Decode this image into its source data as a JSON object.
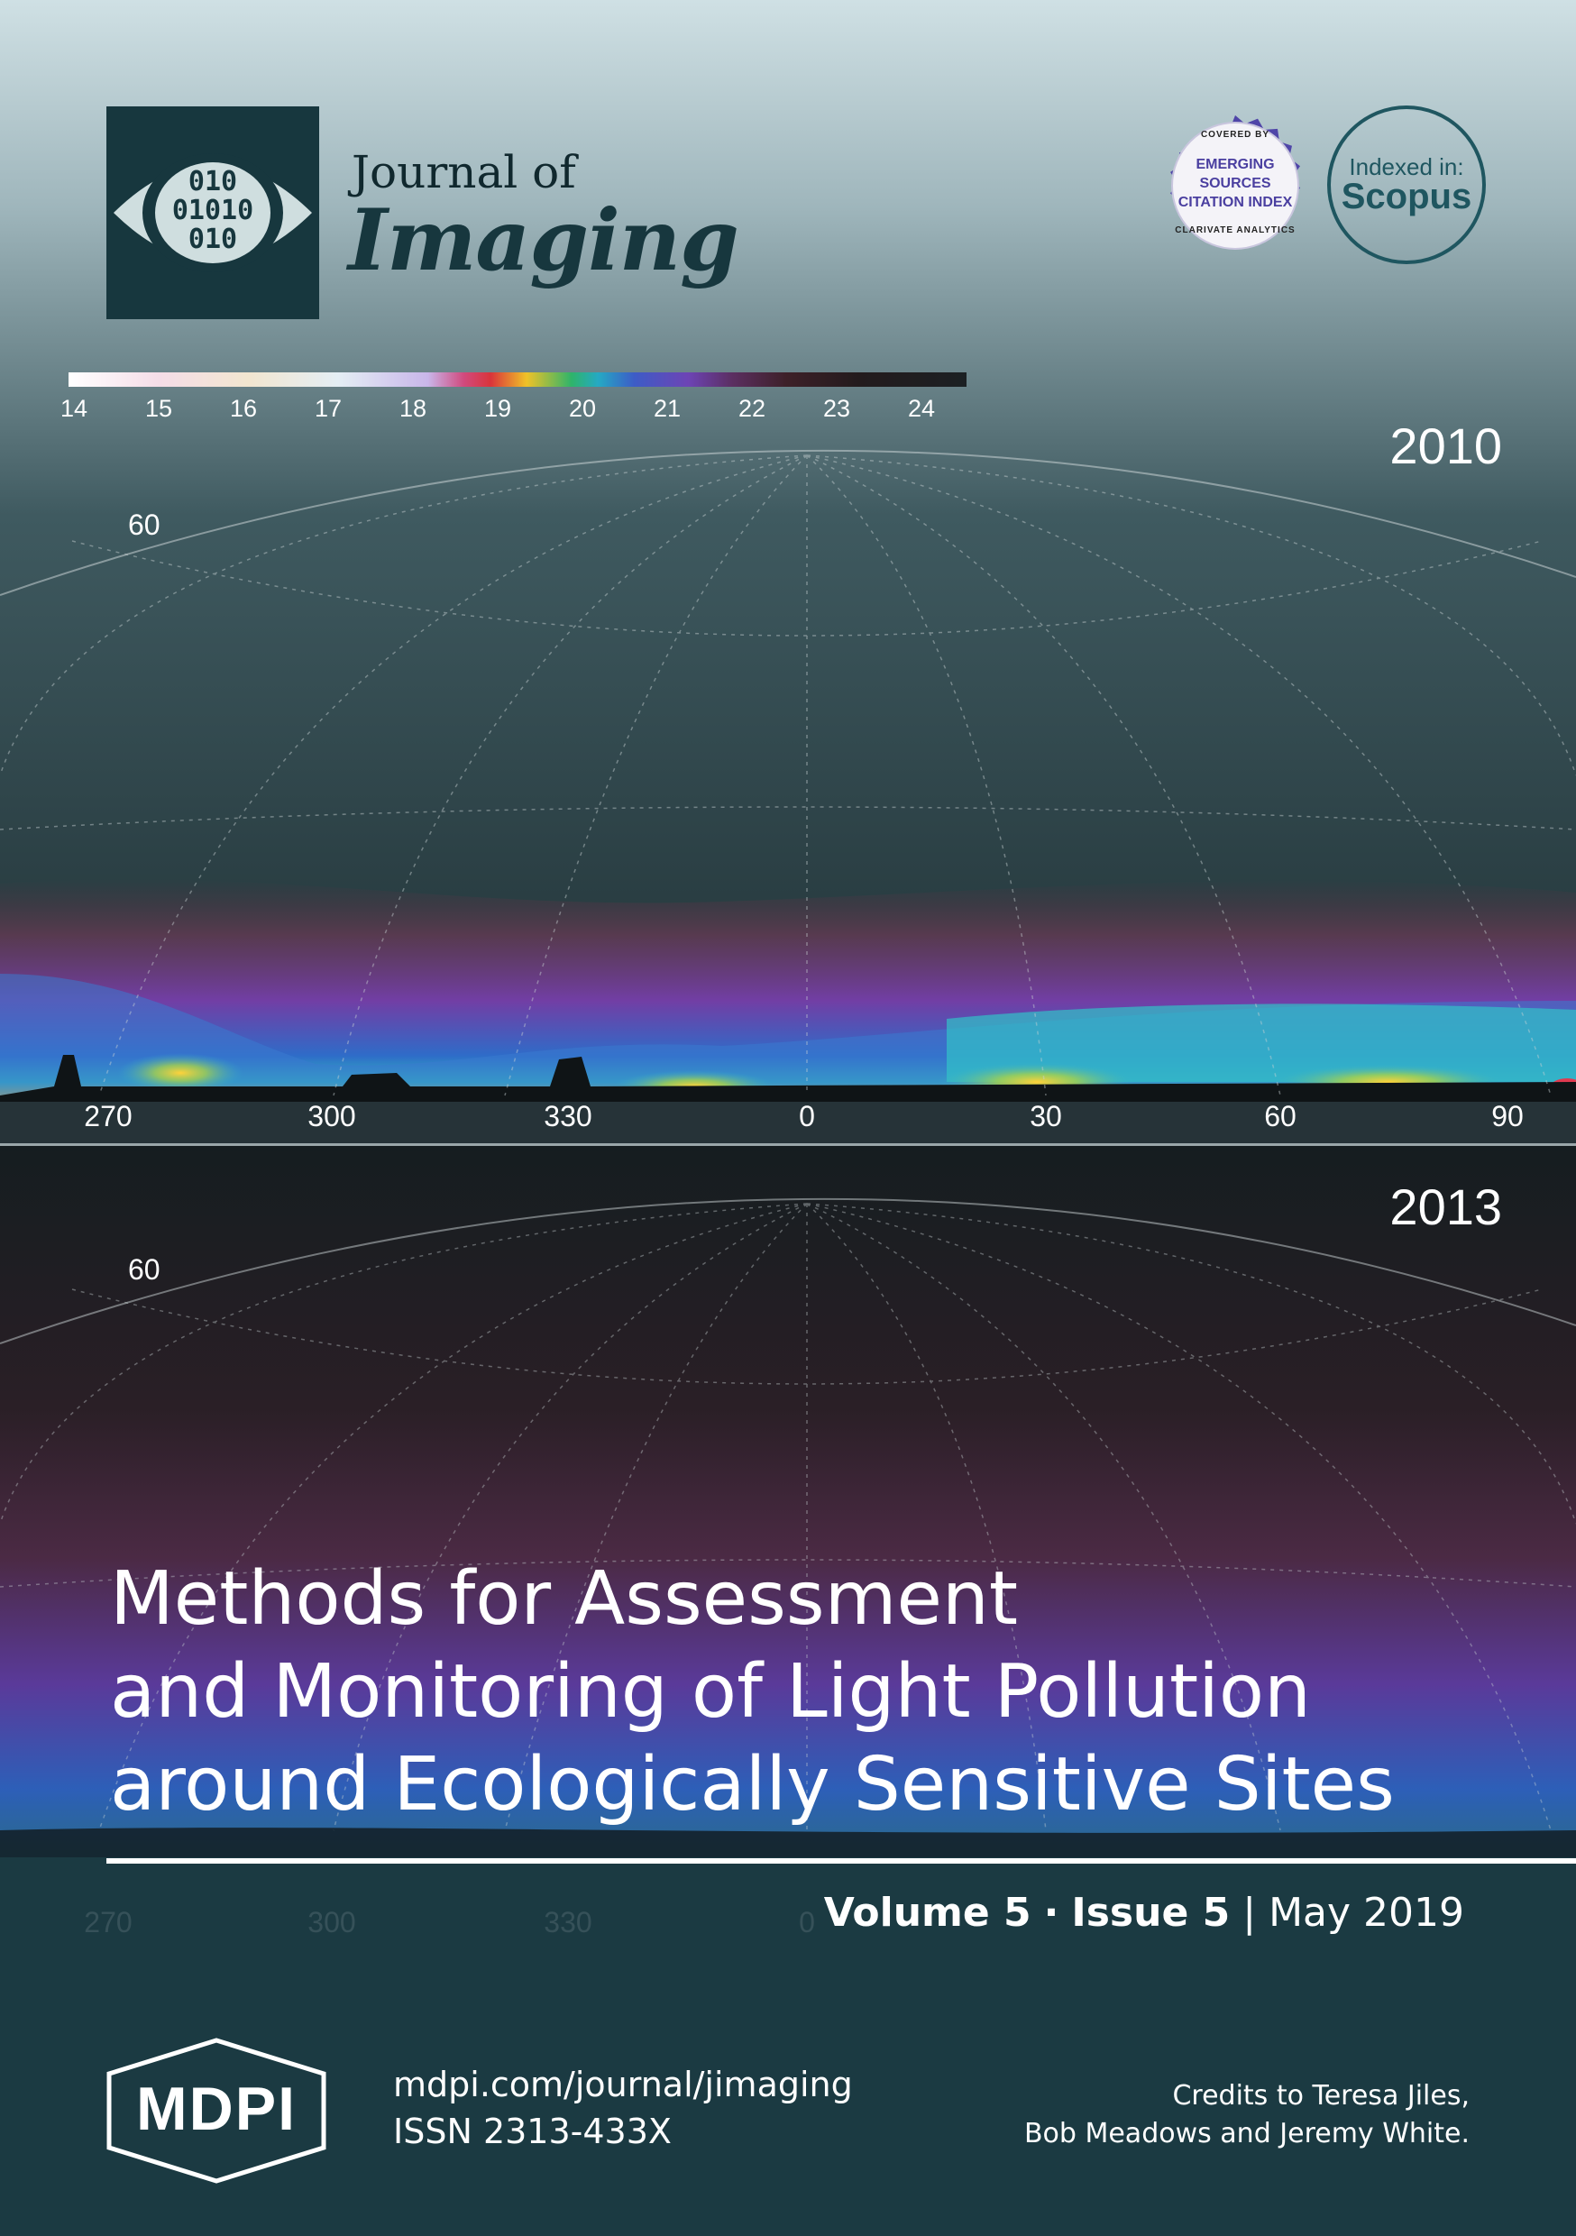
{
  "header": {
    "logo_digits": [
      "010",
      "01010",
      "010"
    ],
    "journal_prefix": "Journal of",
    "journal_name": "Imaging",
    "esci_badge": {
      "top_text": "COVERED BY",
      "lines": [
        "EMERGING",
        "SOURCES",
        "CITATION INDEX"
      ],
      "bottom_text": "CLARIVATE ANALYTICS",
      "accent_color": "#4a3fa0"
    },
    "scopus_badge": {
      "indexed_label": "Indexed in:",
      "name": "Scopus",
      "color": "#1f5660"
    }
  },
  "colorbar": {
    "ticks": [
      "14",
      "15",
      "16",
      "17",
      "18",
      "19",
      "20",
      "21",
      "22",
      "23",
      "24"
    ]
  },
  "panels": [
    {
      "year": "2010",
      "altitude_label": "60",
      "azimuth_ticks": [
        "270",
        "300",
        "330",
        "0",
        "30",
        "60",
        "90"
      ]
    },
    {
      "year": "2013",
      "altitude_label": "60",
      "azimuth_ticks": [
        "270",
        "300",
        "330",
        "0"
      ]
    }
  ],
  "article": {
    "title_lines": [
      "Methods for Assessment",
      "and Monitoring of Light Pollution",
      "around Ecologically Sensitive Sites"
    ]
  },
  "issue": {
    "volume": "Volume 5",
    "separator": "·",
    "issue": "Issue 5",
    "divider": "|",
    "date": "May 2019"
  },
  "footer": {
    "publisher": "MDPI",
    "url": "mdpi.com/journal/jimaging",
    "issn": "ISSN 2313-433X",
    "credits_lines": [
      "Credits to Teresa Jiles,",
      "Bob Meadows and Jeremy White."
    ]
  },
  "colors": {
    "brand_dark": "#17373e",
    "footer_bg": "#1b3a42"
  }
}
